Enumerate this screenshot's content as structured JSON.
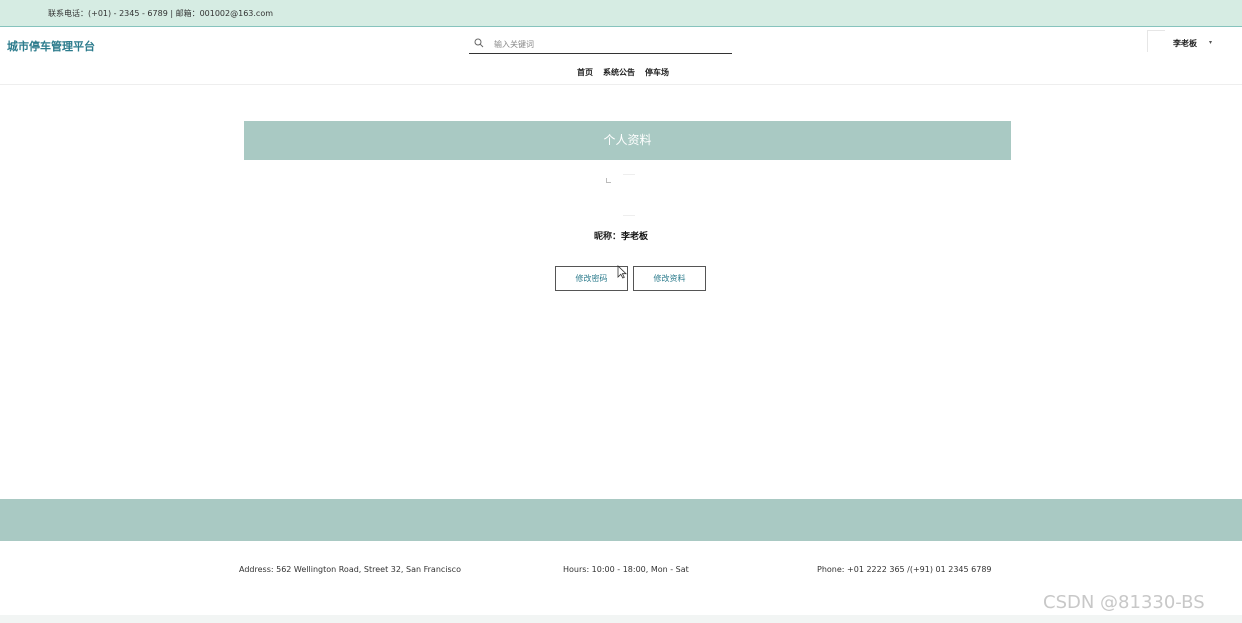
{
  "topbar": {
    "contact": "联系电话：(+01) - 2345 - 6789 | 邮箱：001002@163.com"
  },
  "header": {
    "brand": "城市停车管理平台",
    "search_placeholder": "输入关键词",
    "nav": [
      "首页",
      "系统公告",
      "停车场"
    ],
    "user_name": "李老板",
    "caret": "▾"
  },
  "profile": {
    "title": "个人资料",
    "nickname_label": "昵称：",
    "nickname_value": "李老板",
    "change_password": "修改密码",
    "edit_profile": "修改资料"
  },
  "footer": {
    "address": "Address: 562 Wellington Road, Street 32, San Francisco",
    "hours": "Hours: 10:00 - 18:00, Mon - Sat",
    "phone": "Phone: +01 2222 365 /(+91) 01 2345 6789"
  },
  "watermark": "CSDN @81330-BS",
  "colors": {
    "accent": "#2b7b8c",
    "band": "#a9c9c3",
    "topbar": "#d6ece3"
  }
}
